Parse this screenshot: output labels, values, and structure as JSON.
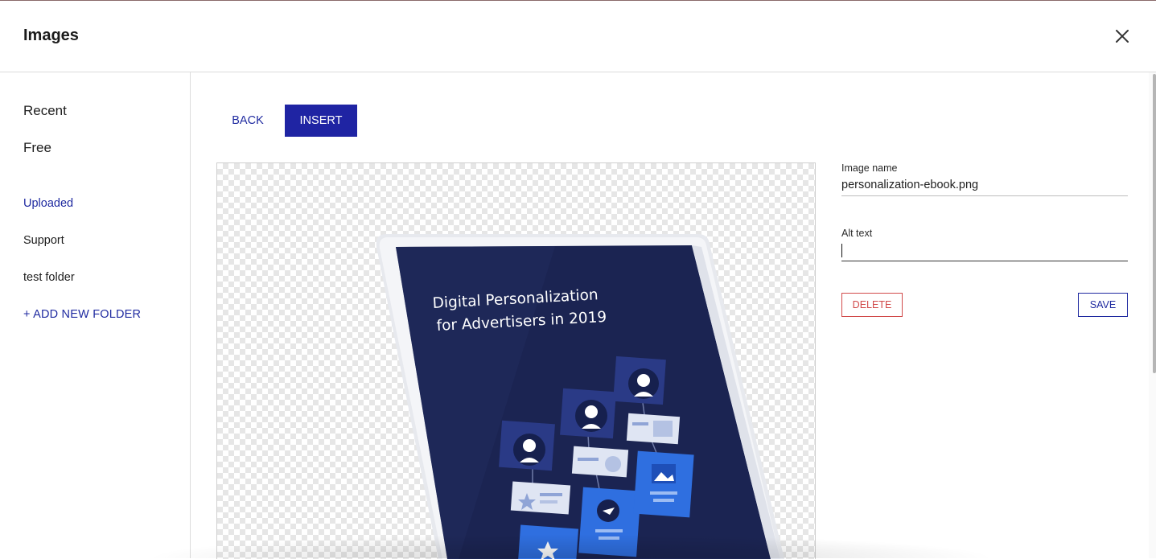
{
  "dialog": {
    "title": "Images"
  },
  "sidebar": {
    "items": [
      {
        "label": "Recent"
      },
      {
        "label": "Free"
      },
      {
        "label": "Uploaded",
        "active": true
      },
      {
        "label": "Support"
      },
      {
        "label": "test folder"
      }
    ],
    "add_folder_label": "+ ADD NEW FOLDER"
  },
  "toolbar": {
    "back_label": "BACK",
    "insert_label": "INSERT"
  },
  "preview": {
    "cover_title_line1": "Digital Personalization",
    "cover_title_line2": "for Advertisers in 2019"
  },
  "details": {
    "image_name_label": "Image name",
    "image_name_value": "personalization-ebook.png",
    "alt_text_label": "Alt text",
    "alt_text_value": "",
    "delete_label": "DELETE",
    "save_label": "SAVE"
  },
  "colors": {
    "accent": "#1f24a3",
    "danger": "#d14a4a",
    "cover_bg": "#1b2452",
    "tile_blue": "#2f6fe0"
  },
  "icons": {
    "close": "close-icon"
  }
}
